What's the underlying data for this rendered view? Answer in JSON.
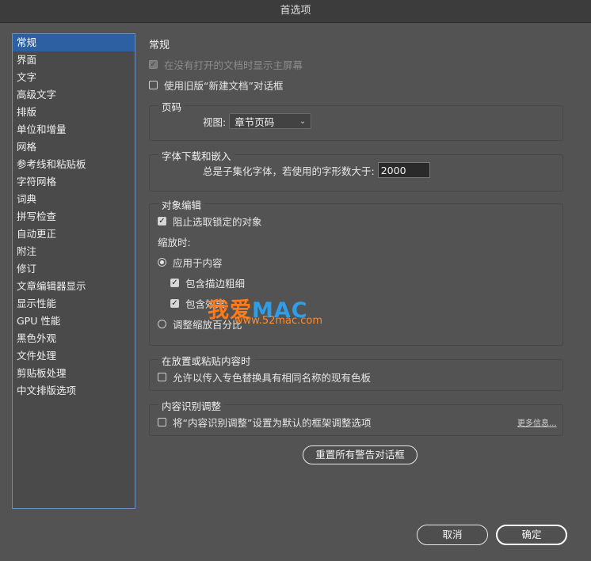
{
  "window": {
    "title": "首选项"
  },
  "sidebar": {
    "items": [
      {
        "label": "常规",
        "active": true
      },
      {
        "label": "界面"
      },
      {
        "label": "文字"
      },
      {
        "label": "高级文字"
      },
      {
        "label": "排版"
      },
      {
        "label": "单位和增量"
      },
      {
        "label": "网格"
      },
      {
        "label": "参考线和粘贴板"
      },
      {
        "label": "字符网格"
      },
      {
        "label": "词典"
      },
      {
        "label": "拼写检查"
      },
      {
        "label": "自动更正"
      },
      {
        "label": "附注"
      },
      {
        "label": "修订"
      },
      {
        "label": "文章编辑器显示"
      },
      {
        "label": "显示性能"
      },
      {
        "label": "GPU 性能"
      },
      {
        "label": "黑色外观"
      },
      {
        "label": "文件处理"
      },
      {
        "label": "剪贴板处理"
      },
      {
        "label": "中文排版选项"
      }
    ]
  },
  "general": {
    "section_title": "常规",
    "show_home_label": "在没有打开的文档时显示主屏幕",
    "legacy_new_doc_label": "使用旧版“新建文档”对话框"
  },
  "page_numbering": {
    "group_label": "页码",
    "view_label": "视图:",
    "view_value": "章节页码"
  },
  "font_download": {
    "group_label": "字体下载和嵌入",
    "subset_label": "总是子集化字体，若使用的字形数大于:",
    "subset_value": "2000"
  },
  "object_editing": {
    "group_label": "对象编辑",
    "prevent_locked_label": "阻止选取锁定的对象",
    "when_scaling_label": "缩放时:",
    "apply_to_content_label": "应用于内容",
    "include_stroke_label": "包含描边粗细",
    "include_effects_label": "包含效果",
    "adjust_percentage_label": "调整缩放百分比"
  },
  "placing": {
    "group_label": "在放置或粘贴内容时",
    "allow_spot_label": "允许以传入专色替换具有相同名称的现有色板"
  },
  "content_aware": {
    "group_label": "内容识别调整",
    "default_fitting_label": "将“内容识别调整”设置为默认的框架调整选项",
    "more_info": "更多信息..."
  },
  "buttons": {
    "reset_warnings": "重置所有警告对话框",
    "cancel": "取消",
    "ok": "确定"
  },
  "watermark": {
    "cn": "我爱",
    "en": "MAC",
    "url": "www.52mac.com"
  },
  "colors": {
    "panel_bg": "#535353",
    "sidebar_selected": "#2d5fa3",
    "sidebar_border": "#6b8fb8"
  }
}
